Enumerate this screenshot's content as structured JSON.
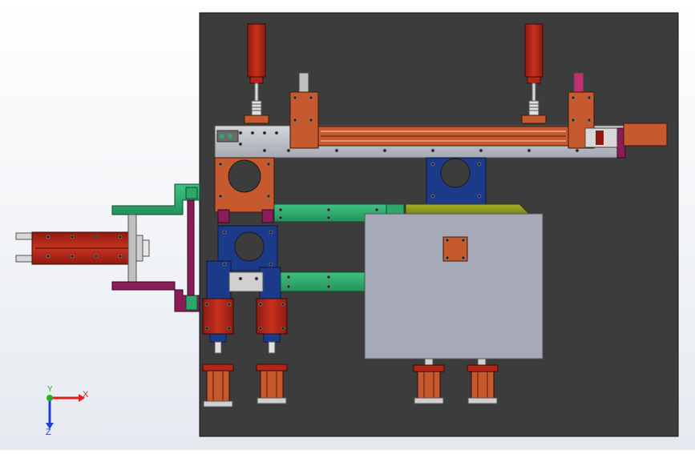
{
  "viewport": {
    "background": "#f2f4f8"
  },
  "triad": {
    "x_label": "X",
    "y_label": "Y",
    "z_label": "Z",
    "x_color": "#e02020",
    "y_color": "#20b020",
    "z_color": "#2040d0"
  },
  "colors": {
    "base_plate": "#3c3c3c",
    "cylinder_red": "#b2261a",
    "bracket_orange": "#c65a2e",
    "rail_green": "#2ea86a",
    "mount_blue": "#1c3a8a",
    "steel_grey": "#b9bcc4",
    "plate_lavender": "#a5a9b8",
    "accent_magenta": "#8a1c5a",
    "olive": "#8f9a1e"
  },
  "components": [
    "base-plate",
    "top-cylinder-left",
    "top-cylinder-right",
    "horizontal-beam",
    "linear-actuator",
    "left-side-cylinder",
    "clamp-mount-upper",
    "clamp-mount-right",
    "clamp-mount-lower",
    "rail-upper",
    "rail-lower",
    "work-plate",
    "bottom-cylinder-1",
    "bottom-cylinder-2",
    "bottom-cylinder-3",
    "bottom-cylinder-4"
  ]
}
